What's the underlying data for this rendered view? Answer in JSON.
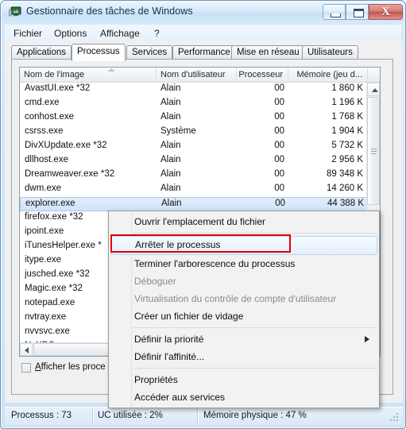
{
  "window": {
    "title": "Gestionnaire des tâches de Windows",
    "icon": "task-manager-icon",
    "minimize_label": "",
    "maximize_label": "",
    "close_label": "X"
  },
  "menubar": {
    "items": [
      {
        "label": "Fichier",
        "name": "menu-fichier"
      },
      {
        "label": "Options",
        "name": "menu-options"
      },
      {
        "label": "Affichage",
        "name": "menu-affichage"
      },
      {
        "label": "?",
        "name": "menu-help"
      }
    ]
  },
  "tabs": [
    {
      "label": "Applications",
      "active": false
    },
    {
      "label": "Processus",
      "active": true
    },
    {
      "label": "Services",
      "active": false
    },
    {
      "label": "Performance",
      "active": false
    },
    {
      "label": "Mise en réseau",
      "active": false
    },
    {
      "label": "Utilisateurs",
      "active": false
    }
  ],
  "process_table": {
    "columns": [
      "Nom de l'image",
      "Nom d'utilisateur",
      "Processeur",
      "Mémoire (jeu d..."
    ],
    "sort_column": "Nom de l'image",
    "sort_direction": "ascending",
    "rows": [
      {
        "name": "AvastUI.exe *32",
        "user": "Alain",
        "cpu": "00",
        "memory": "1 860 K",
        "selected": false
      },
      {
        "name": "cmd.exe",
        "user": "Alain",
        "cpu": "00",
        "memory": "1 196 K",
        "selected": false
      },
      {
        "name": "conhost.exe",
        "user": "Alain",
        "cpu": "00",
        "memory": "1 768 K",
        "selected": false
      },
      {
        "name": "csrss.exe",
        "user": "Système",
        "cpu": "00",
        "memory": "1 904 K",
        "selected": false
      },
      {
        "name": "DivXUpdate.exe *32",
        "user": "Alain",
        "cpu": "00",
        "memory": "5 732 K",
        "selected": false
      },
      {
        "name": "dllhost.exe",
        "user": "Alain",
        "cpu": "00",
        "memory": "2 956 K",
        "selected": false
      },
      {
        "name": "Dreamweaver.exe *32",
        "user": "Alain",
        "cpu": "00",
        "memory": "89 348 K",
        "selected": false
      },
      {
        "name": "dwm.exe",
        "user": "Alain",
        "cpu": "00",
        "memory": "14 260 K",
        "selected": false
      },
      {
        "name": "explorer.exe",
        "user": "Alain",
        "cpu": "00",
        "memory": "44 388 K",
        "selected": true
      },
      {
        "name": "firefox.exe *32",
        "user": "",
        "cpu": "",
        "memory": "",
        "selected": false
      },
      {
        "name": "ipoint.exe",
        "user": "",
        "cpu": "",
        "memory": "",
        "selected": false
      },
      {
        "name": "iTunesHelper.exe *",
        "user": "",
        "cpu": "",
        "memory": "",
        "selected": false
      },
      {
        "name": "itype.exe",
        "user": "",
        "cpu": "",
        "memory": "",
        "selected": false
      },
      {
        "name": "jusched.exe *32",
        "user": "",
        "cpu": "",
        "memory": "",
        "selected": false
      },
      {
        "name": "Magic.exe *32",
        "user": "",
        "cpu": "",
        "memory": "",
        "selected": false
      },
      {
        "name": "notepad.exe",
        "user": "",
        "cpu": "",
        "memory": "",
        "selected": false
      },
      {
        "name": "nvtray.exe",
        "user": "",
        "cpu": "",
        "memory": "",
        "selected": false
      },
      {
        "name": "nvvsvc.exe",
        "user": "",
        "cpu": "",
        "memory": "",
        "selected": false
      },
      {
        "name": "NvXDSync.exe",
        "user": "",
        "cpu": "",
        "memory": "",
        "selected": false
      }
    ]
  },
  "show_all_processes": {
    "label_accel": "A",
    "label_rest": "fficher les proce",
    "checked": false
  },
  "context_menu": {
    "items": [
      {
        "label": "Ouvrir l'emplacement du fichier",
        "state": "normal",
        "submenu": false
      },
      {
        "label": "SEPARATOR",
        "state": "separator",
        "submenu": false
      },
      {
        "label": "Arrêter le processus",
        "state": "highlighted",
        "submenu": false
      },
      {
        "label": "Terminer l'arborescence du processus",
        "state": "normal",
        "submenu": false
      },
      {
        "label": "Déboguer",
        "state": "disabled",
        "submenu": false
      },
      {
        "label": "Virtualisation du contrôle de compte d'utilisateur",
        "state": "disabled",
        "submenu": false
      },
      {
        "label": "Créer un fichier de vidage",
        "state": "normal",
        "submenu": false
      },
      {
        "label": "SEPARATOR",
        "state": "separator",
        "submenu": false
      },
      {
        "label": "Définir la priorité",
        "state": "normal",
        "submenu": true
      },
      {
        "label": "Définir l'affinité...",
        "state": "normal",
        "submenu": false
      },
      {
        "label": "SEPARATOR",
        "state": "separator",
        "submenu": false
      },
      {
        "label": "Propriétés",
        "state": "normal",
        "submenu": false
      },
      {
        "label": "Accéder aux services",
        "state": "normal",
        "submenu": false
      }
    ]
  },
  "annotation": {
    "color": "#e00000",
    "target": "Arrêter le processus"
  },
  "statusbar": {
    "processes": "Processus : 73",
    "cpu_usage": "UC utilisée : 2%",
    "physical_memory": "Mémoire physique : 47 %"
  }
}
